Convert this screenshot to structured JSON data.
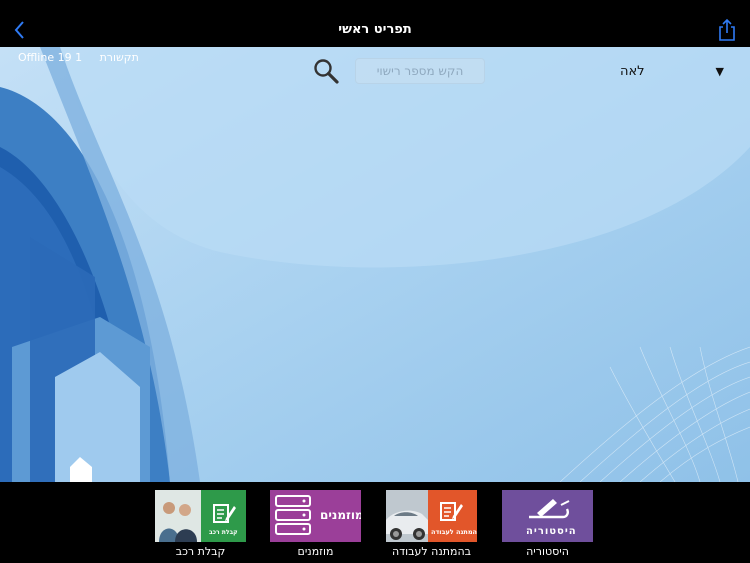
{
  "header": {
    "title": "תפריט ראשי"
  },
  "status": {
    "offline_label": "Offline 19 1",
    "connection_label": "תקשורת"
  },
  "search": {
    "placeholder": "הקש מספר רישוי"
  },
  "dropdown": {
    "selected": "לאה"
  },
  "tiles": [
    {
      "label": "קבלת רכב",
      "inner_text": "קבלת רכב",
      "color": "#2e9a4a"
    },
    {
      "label": "מוזמנים",
      "inner_text": "מוזמנים",
      "color": "#9b3f99"
    },
    {
      "label": "בהמתנה לעבודה",
      "inner_text": "בהמתנה לעבודה",
      "color": "#e2562a"
    },
    {
      "label": "היסטוריה",
      "inner_text": "היסטוריה",
      "color": "#6f4f9c"
    }
  ],
  "colors": {
    "accent": "#2f7bf5",
    "background": "#9cc9ec",
    "bar": "#000000"
  }
}
